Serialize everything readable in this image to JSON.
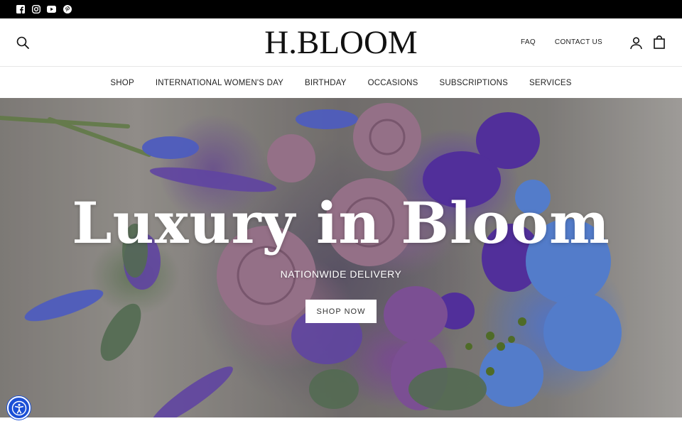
{
  "social": {
    "items": [
      {
        "name": "facebook",
        "icon": "facebook-icon"
      },
      {
        "name": "instagram",
        "icon": "instagram-icon"
      },
      {
        "name": "youtube",
        "icon": "youtube-icon"
      },
      {
        "name": "pinterest",
        "icon": "pinterest-icon"
      }
    ]
  },
  "header": {
    "logo": "H.BLOOM",
    "links": [
      {
        "label": "FAQ"
      },
      {
        "label": "CONTACT US"
      }
    ],
    "icons": {
      "search": "search-icon",
      "account": "account-icon",
      "cart": "shopping-bag-icon"
    }
  },
  "nav": {
    "items": [
      {
        "label": "SHOP"
      },
      {
        "label": "INTERNATIONAL WOMEN'S DAY"
      },
      {
        "label": "BIRTHDAY"
      },
      {
        "label": "OCCASIONS"
      },
      {
        "label": "SUBSCRIPTIONS"
      },
      {
        "label": "SERVICES"
      }
    ]
  },
  "hero": {
    "title": "Luxury in Bloom",
    "subtitle": "NATIONWIDE DELIVERY",
    "button": "SHOP NOW"
  },
  "accessibility": {
    "icon": "accessibility-icon"
  },
  "colors": {
    "topbar": "#000000",
    "accessibility_button": "#1a4fd6",
    "hero_text": "#ffffff"
  }
}
